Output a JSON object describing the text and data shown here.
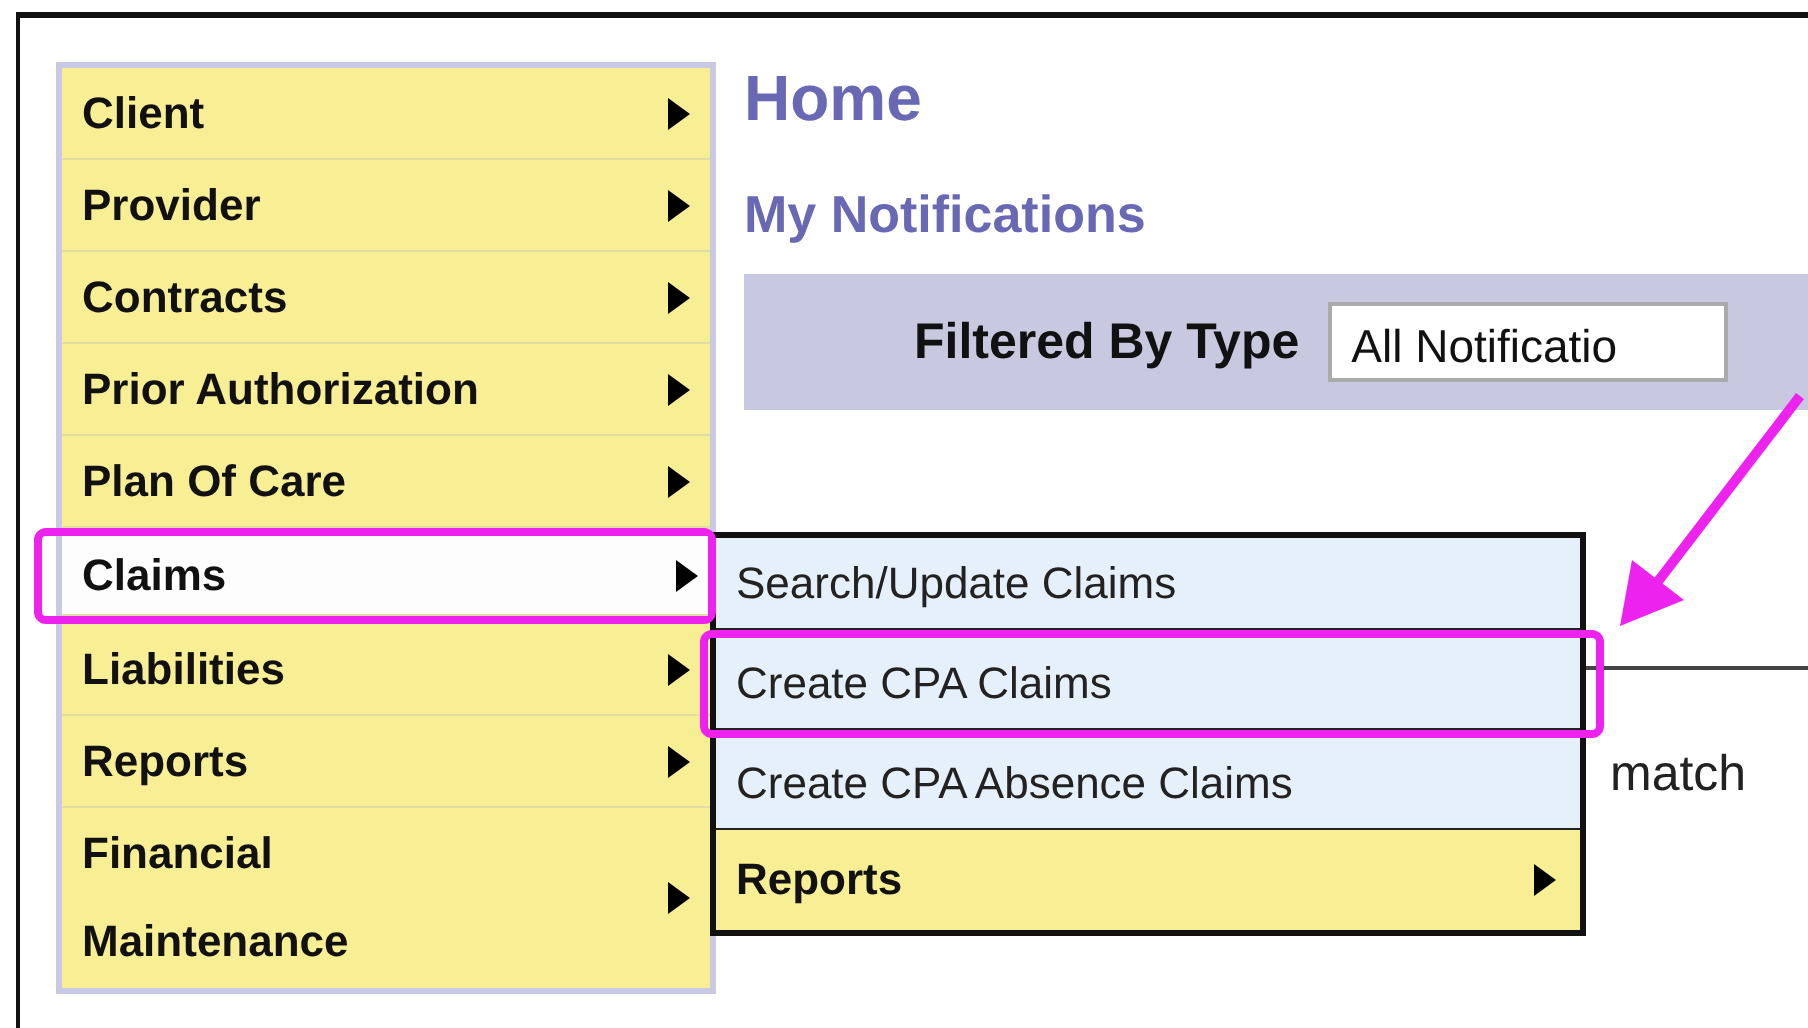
{
  "sidebar": {
    "items": [
      {
        "label": "Client",
        "selected": false,
        "highlighted": false
      },
      {
        "label": "Provider",
        "selected": false,
        "highlighted": false
      },
      {
        "label": "Contracts",
        "selected": false,
        "highlighted": false
      },
      {
        "label": "Prior Authorization",
        "selected": false,
        "highlighted": false
      },
      {
        "label": "Plan Of Care",
        "selected": false,
        "highlighted": false
      },
      {
        "label": "Claims",
        "selected": true,
        "highlighted": true
      },
      {
        "label": "Liabilities",
        "selected": false,
        "highlighted": false
      },
      {
        "label": "Reports",
        "selected": false,
        "highlighted": false
      },
      {
        "label": "Financial Maintenance",
        "selected": false,
        "highlighted": false
      }
    ]
  },
  "submenu": {
    "items": [
      {
        "label": "Search/Update Claims",
        "kind": "link",
        "highlighted": false
      },
      {
        "label": "Create CPA Claims",
        "kind": "link",
        "highlighted": true
      },
      {
        "label": "Create CPA Absence Claims",
        "kind": "link",
        "highlighted": false
      },
      {
        "label": "Reports",
        "kind": "folder",
        "highlighted": false
      }
    ]
  },
  "page": {
    "title": "Home",
    "subtitle": "My Notifications",
    "filter": {
      "label": "Filtered By Type",
      "value": "All Notificatio"
    },
    "message": "match"
  }
}
